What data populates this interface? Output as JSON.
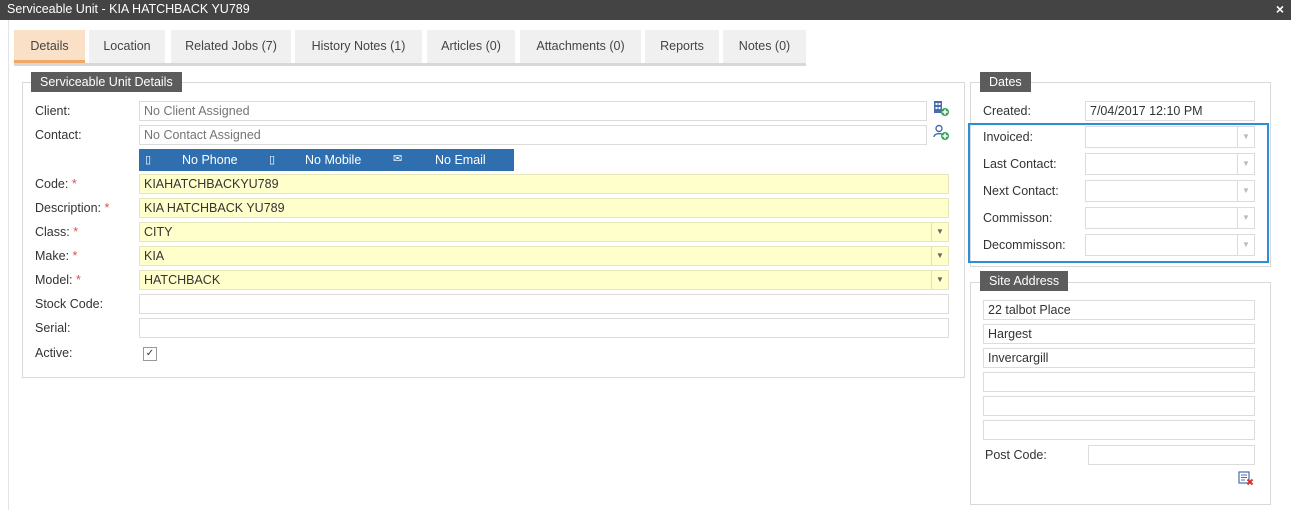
{
  "window": {
    "title": "Serviceable Unit - KIA HATCHBACK YU789",
    "close_glyph": "×"
  },
  "tabs": [
    {
      "label": "Details"
    },
    {
      "label": "Location"
    },
    {
      "label": "Related Jobs (7)"
    },
    {
      "label": "History Notes (1)"
    },
    {
      "label": "Articles (0)"
    },
    {
      "label": "Attachments (0)"
    },
    {
      "label": "Reports"
    },
    {
      "label": "Notes (0)"
    }
  ],
  "unit_details": {
    "legend": "Serviceable Unit Details",
    "client": {
      "label": "Client:",
      "placeholder": "No Client Assigned"
    },
    "contact": {
      "label": "Contact:",
      "placeholder": "No Contact Assigned"
    },
    "contact_bar": {
      "phone": "No Phone",
      "mobile": "No Mobile",
      "email": "No Email"
    },
    "code": {
      "label": "Code:",
      "value": "KIAHATCHBACKYU789"
    },
    "description": {
      "label": "Description:",
      "value": "KIA HATCHBACK YU789"
    },
    "class": {
      "label": "Class:",
      "value": "CITY"
    },
    "make": {
      "label": "Make:",
      "value": "KIA"
    },
    "model": {
      "label": "Model:",
      "value": "HATCHBACK"
    },
    "stock_code": {
      "label": "Stock Code:",
      "value": ""
    },
    "serial": {
      "label": "Serial:",
      "value": ""
    },
    "active": {
      "label": "Active:",
      "checked": true
    },
    "required_mark": "*"
  },
  "dates": {
    "legend": "Dates",
    "created": {
      "label": "Created:",
      "value": "7/04/2017 12:10 PM"
    },
    "invoiced": {
      "label": "Invoiced:",
      "value": ""
    },
    "last_contact": {
      "label": "Last Contact:",
      "value": ""
    },
    "next_contact": {
      "label": "Next Contact:",
      "value": ""
    },
    "commission": {
      "label": "Commisson:",
      "value": ""
    },
    "decommission": {
      "label": "Decommisson:",
      "value": ""
    }
  },
  "site_address": {
    "legend": "Site Address",
    "line1": "22 talbot Place",
    "line2": "Hargest",
    "line3": "Invercargill",
    "line4": "",
    "line5": "",
    "line6": "",
    "post_code": {
      "label": "Post Code:",
      "value": ""
    }
  },
  "colors": {
    "accent_tab": "#f2a766",
    "contact_bar": "#2f6fb0",
    "highlight": "#2b8fd6",
    "required_bg": "#ffffcc"
  }
}
